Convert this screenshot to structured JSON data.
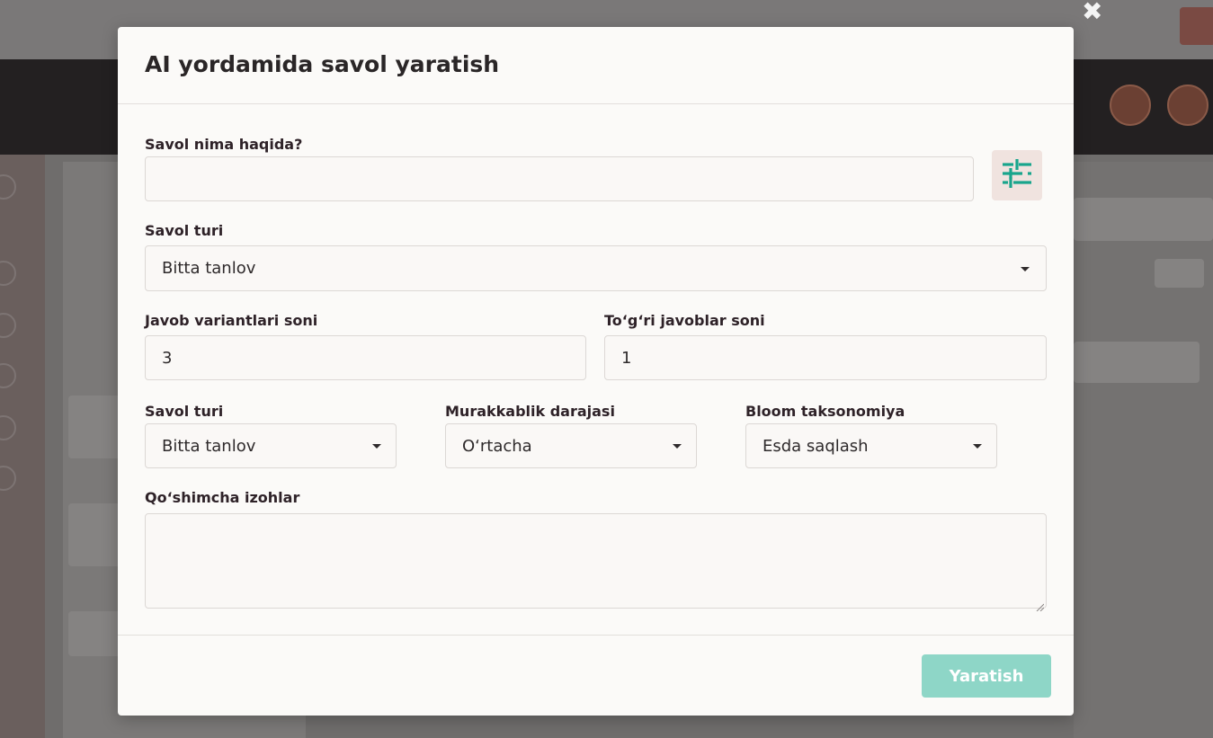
{
  "modal": {
    "title": "AI yordamida savol yaratish",
    "topic": {
      "label": "Savol nima haqida?",
      "value": "",
      "placeholder": ""
    },
    "question_type_main": {
      "label": "Savol turi",
      "value": "Bitta tanlov"
    },
    "answer_count": {
      "label": "Javob variantlari soni",
      "value": "3"
    },
    "correct_count": {
      "label": "To‘g‘ri javoblar soni",
      "value": "1"
    },
    "question_type": {
      "label": "Savol turi",
      "value": "Bitta tanlov"
    },
    "difficulty": {
      "label": "Murakkablik darajasi",
      "value": "O‘rtacha"
    },
    "bloom": {
      "label": "Bloom taksonomiya",
      "value": "Esda saqlash"
    },
    "notes": {
      "label": "Qo‘shimcha izohlar",
      "value": ""
    },
    "submit_label": "Yaratish",
    "settings_icon": "sliders-icon",
    "accent_color": "#18a58c",
    "submit_color": "#8ed6c7"
  },
  "background": {
    "close_icon": "close-icon"
  }
}
